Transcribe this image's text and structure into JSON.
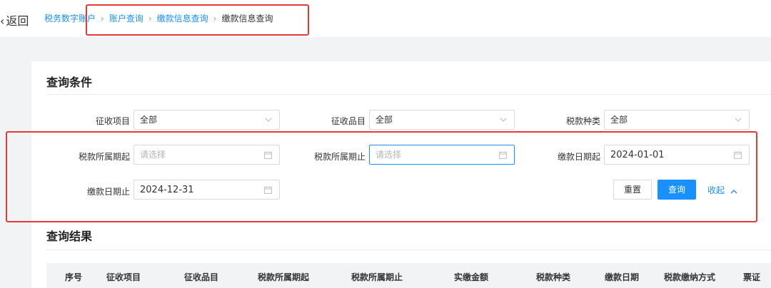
{
  "header": {
    "back_label": "返回",
    "breadcrumb": [
      "税务数字账户",
      "账户查询",
      "缴款信息查询",
      "缴款信息查询"
    ]
  },
  "query": {
    "title": "查询条件",
    "fields": {
      "collection_item": {
        "label": "征收项目",
        "value": "全部"
      },
      "collection_subitem": {
        "label": "征收品目",
        "value": "全部"
      },
      "tax_type": {
        "label": "税款种类",
        "value": "全部"
      },
      "period_start": {
        "label": "税款所属期起",
        "placeholder": "请选择"
      },
      "period_end": {
        "label": "税款所属期止",
        "placeholder": "请选择"
      },
      "pay_date_start": {
        "label": "缴款日期起",
        "value": "2024-01-01"
      },
      "pay_date_end": {
        "label": "缴款日期止",
        "value": "2024-12-31"
      }
    },
    "buttons": {
      "reset": "重置",
      "search": "查询",
      "collapse": "收起"
    }
  },
  "result": {
    "title": "查询结果",
    "columns": [
      "序号",
      "征收项目",
      "征收品目",
      "税款所属期起",
      "税款所属期止",
      "实缴金额",
      "税款种类",
      "缴款日期",
      "税款缴纳方式",
      "票证"
    ]
  },
  "colors": {
    "accent": "#1890ff",
    "highlight_border": "#e53935",
    "page_bg": "#f2f3f5"
  }
}
